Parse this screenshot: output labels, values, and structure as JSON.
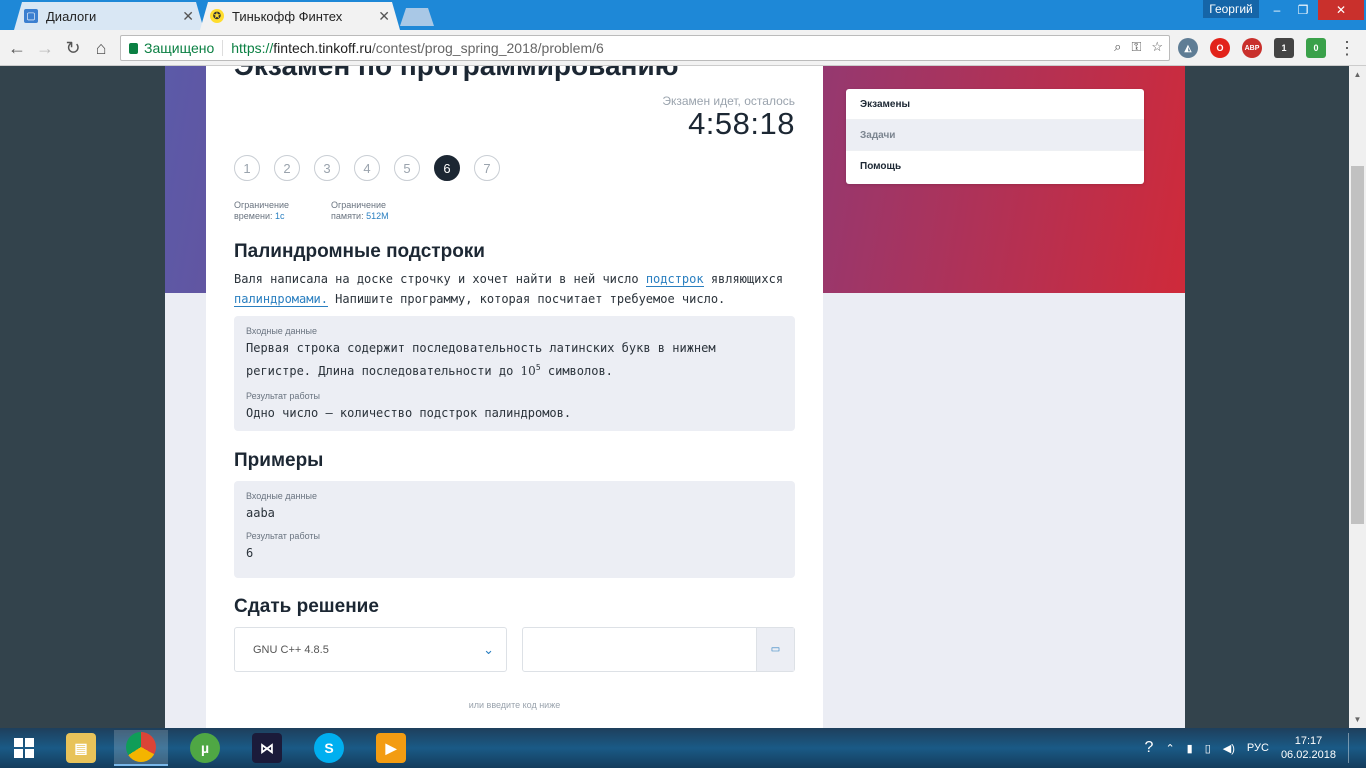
{
  "browser": {
    "tabs": [
      {
        "label": "Диалоги",
        "icon": "chat-icon"
      },
      {
        "label": "Тинькофф Финтех",
        "icon": "tinkoff-icon"
      }
    ],
    "user_name": "Георгий",
    "secure_label": "Защищено",
    "url": {
      "scheme": "https://",
      "host": "fintech.tinkoff.ru",
      "path": "/contest/prog_spring_2018/problem/6"
    },
    "extension_badges": {
      "ext_one": "1",
      "ext_two": "0"
    }
  },
  "exam": {
    "title": "Экзамен по программированию",
    "time_left_label": "Экзамен идет, осталось",
    "timer": "4:58:18",
    "steps": [
      "1",
      "2",
      "3",
      "4",
      "5",
      "6",
      "7"
    ],
    "active_step": "6",
    "time_limit_label_1": "Ограничение",
    "time_limit_label_2": "времени:",
    "time_limit_value": "1c",
    "memory_limit_label_1": "Ограничение",
    "memory_limit_label_2": "памяти:",
    "memory_limit_value": "512M"
  },
  "problem": {
    "title": "Палиндромные подстроки",
    "desc_part1": "Валя написала на доске строчку и хочет найти в ней число ",
    "desc_link1": "подстрок",
    "desc_part2": " являющихся ",
    "desc_link2": "палиндромами.",
    "desc_part3": " Напишите программу, которая посчитает требуемое число.",
    "input_label": "Входные данные",
    "input_text_1": "Первая строка содержит последовательность латинских букв в нижнем регистре. Длина последовательности до ",
    "input_pow_base": "10",
    "input_pow_exp": "5",
    "input_text_2": " символов.",
    "output_label": "Результат работы",
    "output_text": "Одно число — количество подстрок палиндромов."
  },
  "examples": {
    "title": "Примеры",
    "input_label": "Входные данные",
    "input_value": "aaba",
    "output_label": "Результат работы",
    "output_value": "6"
  },
  "submit": {
    "title": "Сдать решение",
    "compiler": "GNU C++ 4.8.5",
    "or_text": "или введите код ниже"
  },
  "side_menu": [
    {
      "label": "Экзамены",
      "selected": false
    },
    {
      "label": "Задачи",
      "selected": true
    },
    {
      "label": "Помощь",
      "selected": false
    }
  ],
  "taskbar": {
    "apps": [
      "file-explorer",
      "chrome",
      "utorrent",
      "visual-studio",
      "skype",
      "media-player"
    ],
    "lang": "РУС",
    "time": "17:17",
    "date": "06.02.2018"
  }
}
